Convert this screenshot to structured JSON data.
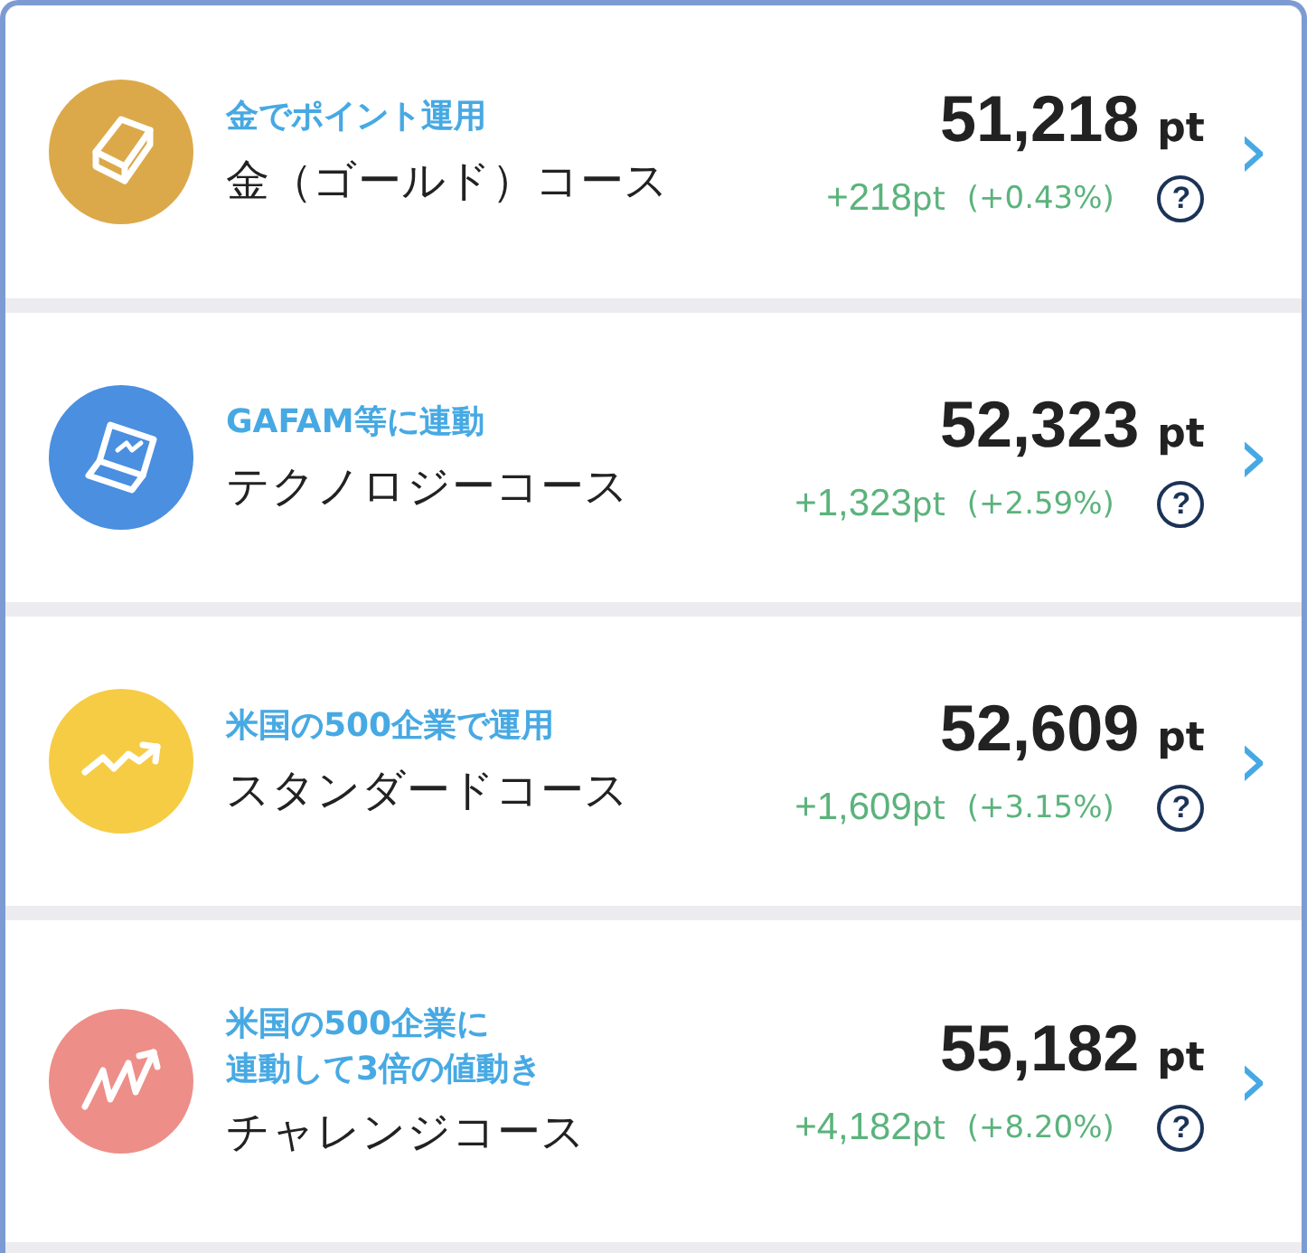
{
  "courses": [
    {
      "kind": "gold",
      "color": "#dca94a",
      "tagline": [
        "金でポイント運用"
      ],
      "name": "金（ゴールド）コース",
      "points": "51,218",
      "unit": "pt",
      "change": "+218",
      "change_unit": "pt",
      "percent": "(+0.43%)",
      "help": "?",
      "arrow": "›"
    },
    {
      "kind": "tech",
      "color": "#4a8fe0",
      "tagline": [
        "GAFAM等に連動"
      ],
      "name": "テクノロジーコース",
      "points": "52,323",
      "unit": "pt",
      "change": "+1,323",
      "change_unit": "pt",
      "percent": "(+2.59%)",
      "help": "?",
      "arrow": "›"
    },
    {
      "kind": "standard",
      "color": "#f6cc45",
      "tagline": [
        "米国の500企業で運用"
      ],
      "name": "スタンダードコース",
      "points": "52,609",
      "unit": "pt",
      "change": "+1,609",
      "change_unit": "pt",
      "percent": "(+3.15%)",
      "help": "?",
      "arrow": "›"
    },
    {
      "kind": "challenge",
      "color": "#ee8e88",
      "tagline": [
        "米国の500企業に",
        "連動して3倍の値動き"
      ],
      "name": "チャレンジコース",
      "points": "55,182",
      "unit": "pt",
      "change": "+4,182",
      "change_unit": "pt",
      "percent": "(+8.20%)",
      "help": "?",
      "arrow": "›"
    }
  ]
}
